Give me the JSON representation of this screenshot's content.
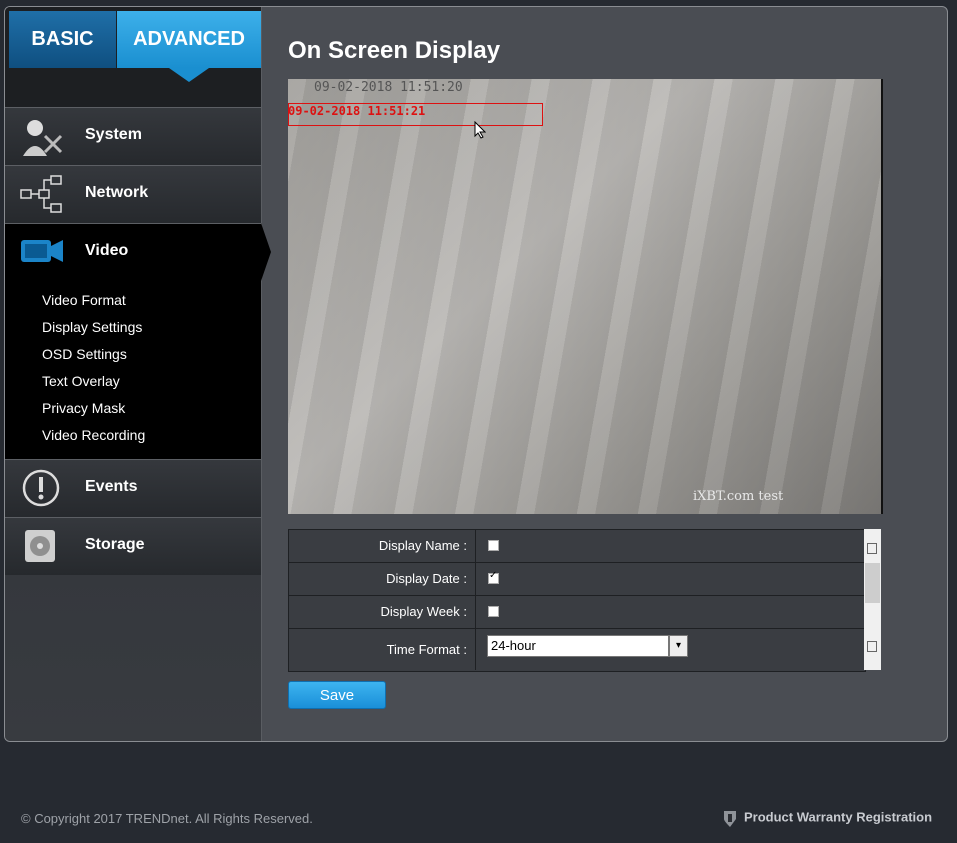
{
  "tabs": {
    "basic": "BASIC",
    "advanced": "ADVANCED"
  },
  "nav": {
    "system": "System",
    "network": "Network",
    "video": "Video",
    "video_sub": [
      "Video Format",
      "Display Settings",
      "OSD Settings",
      "Text Overlay",
      "Privacy Mask",
      "Video Recording"
    ],
    "events": "Events",
    "storage": "Storage"
  },
  "page": {
    "title": "On Screen Display"
  },
  "preview": {
    "gray_stamp": "09-02-2018 11:51:20",
    "red_stamp": "09-02-2018 11:51:21",
    "watermark": "iXBT.com test"
  },
  "form": {
    "display_name": {
      "label": "Display Name :",
      "checked": false
    },
    "display_date": {
      "label": "Display Date :",
      "checked": true
    },
    "display_week": {
      "label": "Display Week :",
      "checked": false
    },
    "time_format": {
      "label": "Time Format :",
      "value": "24-hour"
    },
    "save_label": "Save"
  },
  "footer": {
    "copyright": "© Copyright 2017 TRENDnet. All Rights Reserved.",
    "warranty": "Product Warranty Registration"
  },
  "colors": {
    "accent": "#1a8fd0",
    "stamp_red": "#dd1111"
  }
}
